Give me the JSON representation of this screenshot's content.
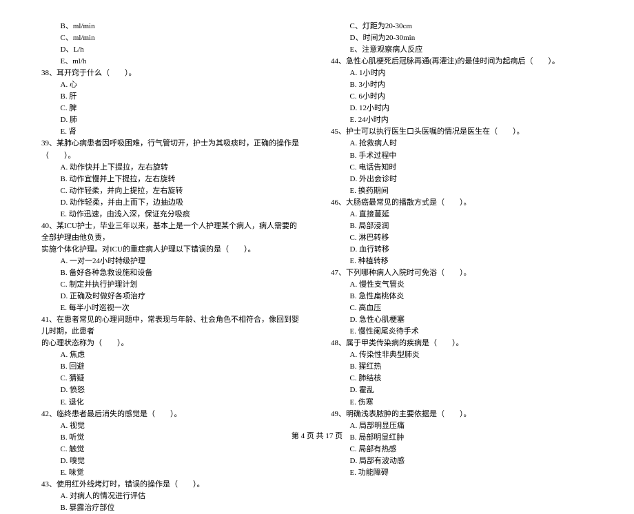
{
  "left": {
    "pre_opts": [
      "B、ml/min",
      "C、ml/min",
      "D、L/h",
      "E、ml/h"
    ],
    "q38": {
      "stem": "38、耳开窍于什么（　　）。",
      "opts": [
        "A. 心",
        "B. 肝",
        "C. 脾",
        "D. 肺",
        "E. 肾"
      ]
    },
    "q39": {
      "stem": "39、某肺心病患者因呼吸困难，行气管切开，护士为其吸痰时，正确的操作是（　　）。",
      "opts": [
        "A. 动作快并上下提拉，左右旋转",
        "B. 动作宜慢并上下提拉，左右旋转",
        "C. 动作轻柔，并向上提拉，左右旋转",
        "D. 动作轻柔，并由上而下，边抽边吸",
        "E. 动作迅速，由浅入深，保证充分吸痰"
      ]
    },
    "q40": {
      "stem1": "40、某ICU护士，毕业三年以来，基本上是一个人护理某个病人，病人需要的全部护理由他负责，",
      "stem2": "实施个体化护理。对ICU的重症病人护理以下错误的是（　　）。",
      "opts": [
        "A. 一对一24小时特级护理",
        "B. 备好各种急救设施和设备",
        "C. 制定并执行护理计划",
        "D. 正确及时做好各项治疗",
        "E. 每半小时巡视一次"
      ]
    },
    "q41": {
      "stem1": "41、在患者常见的心理问题中，常表现与年龄、社会角色不相符合，像回到婴儿时期，此患者",
      "stem2": "的心理状态称为（　　）。",
      "opts": [
        "A. 焦虑",
        "B. 回避",
        "C. 猜疑",
        "D. 愤怒",
        "E. 退化"
      ]
    },
    "q42": {
      "stem": "42、临终患者最后消失的感觉是（　　）。",
      "opts": [
        "A. 视觉",
        "B. 听觉",
        "C. 触觉",
        "D. 嗅觉",
        "E. 味觉"
      ]
    },
    "q43": {
      "stem": "43、使用红外线烤灯时，错误的操作是（　　）。",
      "opts": [
        "A. 对病人的情况进行评估",
        "B. 暴露治疗部位"
      ]
    }
  },
  "right": {
    "pre_opts": [
      "C、灯距为20-30cm",
      "D、时间为20-30min",
      "E、注意观察病人反应"
    ],
    "q44": {
      "stem": "44、急性心肌梗死后冠脉再通(再灌注)的最佳时间为起病后（　　）。",
      "opts": [
        "A. 1小时内",
        "B. 3小时内",
        "C. 6小时内",
        "D. 12小时内",
        "E. 24小时内"
      ]
    },
    "q45": {
      "stem": "45、护士可以执行医生口头医嘱的情况是医生在（　　）。",
      "opts": [
        "A. 抢救病人时",
        "B. 手术过程中",
        "C. 电话告知时",
        "D. 外出会诊时",
        "E. 换药期间"
      ]
    },
    "q46": {
      "stem": "46、大肠癌最常见的播散方式是（　　）。",
      "opts": [
        "A. 直接蔓延",
        "B. 局部浸润",
        "C. 淋巴转移",
        "D. 血行转移",
        "E. 种植转移"
      ]
    },
    "q47": {
      "stem": "47、下列哪种病人入院时可免浴（　　）。",
      "opts": [
        "A. 慢性支气管炎",
        "B. 急性扁桃体炎",
        "C. 高血压",
        "D. 急性心肌梗塞",
        "E. 慢性阑尾炎待手术"
      ]
    },
    "q48": {
      "stem": "48、属于甲类传染病的疾病是（　　）。",
      "opts": [
        "A. 传染性非典型肺炎",
        "B. 猩红热",
        "C. 肺结核",
        "D. 霍乱",
        "E. 伤寒"
      ]
    },
    "q49": {
      "stem": "49、明确浅表脓肿的主要依据是（　　）。",
      "opts": [
        "A. 局部明显压痛",
        "B. 局部明显红肿",
        "C. 局部有热感",
        "D. 局部有波动感",
        "E. 功能障碍"
      ]
    }
  },
  "footer": "第 4 页 共 17 页"
}
